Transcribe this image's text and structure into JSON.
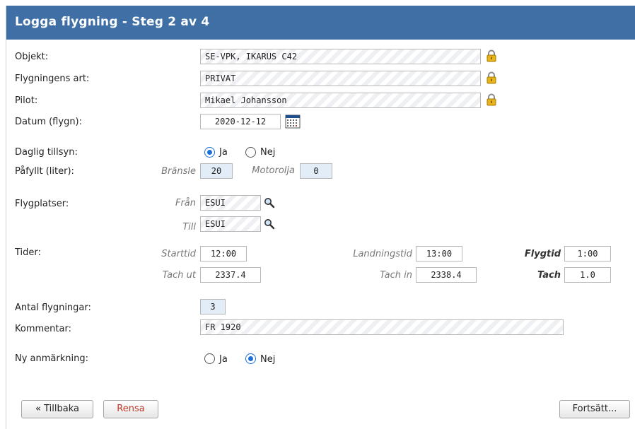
{
  "header": {
    "title": "Logga flygning - Steg 2 av 4"
  },
  "fields": {
    "objekt": {
      "label": "Objekt:",
      "value": "SE-VPK, IKARUS C42"
    },
    "art": {
      "label": "Flygningens art:",
      "value": "PRIVAT"
    },
    "pilot": {
      "label": "Pilot:",
      "value": "Mikael Johansson"
    },
    "datum": {
      "label": "Datum (flygn):",
      "value": "2020-12-12"
    }
  },
  "daglig_tillsyn": {
    "label": "Daglig tillsyn:",
    "options": [
      "Ja",
      "Nej"
    ],
    "selected": "Ja"
  },
  "pafyllt": {
    "label": "Påfyllt (liter):",
    "bransle_label": "Bränsle",
    "bransle": "20",
    "motorolja_label": "Motorolja",
    "motorolja": "0"
  },
  "flygplatser": {
    "label": "Flygplatser:",
    "fran_label": "Från",
    "fran": "ESUI",
    "till_label": "Till",
    "till": "ESUI"
  },
  "tider": {
    "label": "Tider:",
    "starttid_label": "Starttid",
    "starttid": "12:00",
    "landningstid_label": "Landningstid",
    "landningstid": "13:00",
    "flygtid_label": "Flygtid",
    "flygtid": "1:00",
    "tach_ut_label": "Tach ut",
    "tach_ut": "2337.4",
    "tach_in_label": "Tach in",
    "tach_in": "2338.4",
    "tach_label": "Tach",
    "tach": "1.0"
  },
  "antal": {
    "label": "Antal flygningar:",
    "value": "3"
  },
  "kommentar": {
    "label": "Kommentar:",
    "value": "FR 1920"
  },
  "ny_anmarkning": {
    "label": "Ny anmärkning:",
    "options": [
      "Ja",
      "Nej"
    ],
    "selected": "Nej"
  },
  "buttons": {
    "back": "« Tillbaka",
    "reset": "Rensa",
    "next": "Fortsätt..."
  },
  "colors": {
    "header_bg": "#3f6fa5",
    "radio_selected": "#1a6fdc",
    "reset_text": "#c0392b",
    "readonly_field_bg": "#e3edf8"
  }
}
